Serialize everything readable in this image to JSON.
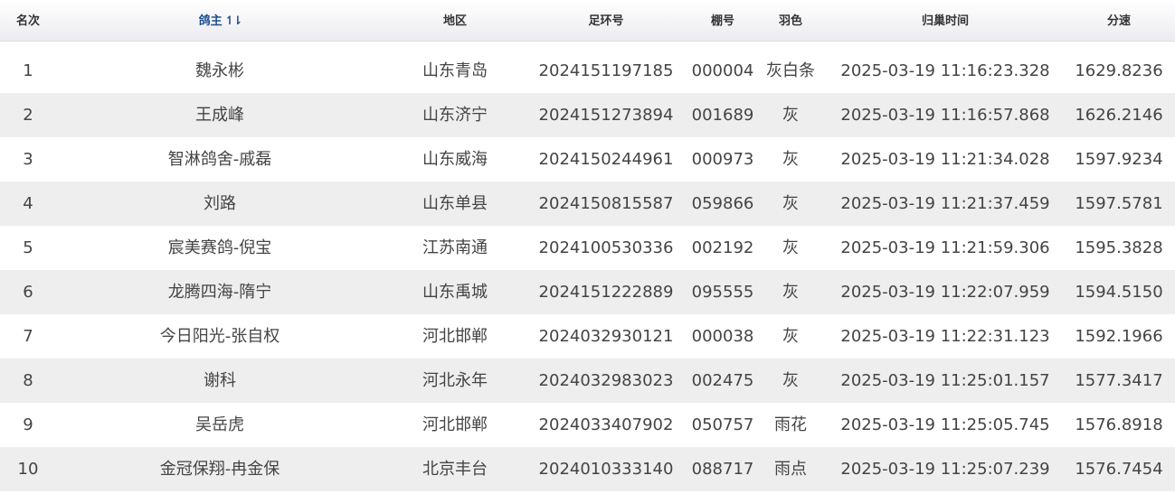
{
  "table": {
    "headers": {
      "rank": "名次",
      "owner": "鸽主",
      "region": "地区",
      "ring": "足环号",
      "shed": "棚号",
      "feather": "羽色",
      "arrival": "归巢时间",
      "speed": "分速"
    },
    "rows": [
      {
        "rank": "1",
        "owner": "魏永彬",
        "region": "山东青岛",
        "ring": "2024151197185",
        "shed": "000004",
        "feather": "灰白条",
        "arrival": "2025-03-19 11:16:23.328",
        "speed": "1629.8236"
      },
      {
        "rank": "2",
        "owner": "王成峰",
        "region": "山东济宁",
        "ring": "2024151273894",
        "shed": "001689",
        "feather": "灰",
        "arrival": "2025-03-19 11:16:57.868",
        "speed": "1626.2146"
      },
      {
        "rank": "3",
        "owner": "智淋鸽舍-戚磊",
        "region": "山东威海",
        "ring": "2024150244961",
        "shed": "000973",
        "feather": "灰",
        "arrival": "2025-03-19 11:21:34.028",
        "speed": "1597.9234"
      },
      {
        "rank": "4",
        "owner": "刘路",
        "region": "山东单县",
        "ring": "2024150815587",
        "shed": "059866",
        "feather": "灰",
        "arrival": "2025-03-19 11:21:37.459",
        "speed": "1597.5781"
      },
      {
        "rank": "5",
        "owner": "宸美赛鸽-倪宝",
        "region": "江苏南通",
        "ring": "2024100530336",
        "shed": "002192",
        "feather": "灰",
        "arrival": "2025-03-19 11:21:59.306",
        "speed": "1595.3828"
      },
      {
        "rank": "6",
        "owner": "龙腾四海-隋宁",
        "region": "山东禹城",
        "ring": "2024151222889",
        "shed": "095555",
        "feather": "灰",
        "arrival": "2025-03-19 11:22:07.959",
        "speed": "1594.5150"
      },
      {
        "rank": "7",
        "owner": "今日阳光-张自权",
        "region": "河北邯郸",
        "ring": "2024032930121",
        "shed": "000038",
        "feather": "灰",
        "arrival": "2025-03-19 11:22:31.123",
        "speed": "1592.1966"
      },
      {
        "rank": "8",
        "owner": "谢科",
        "region": "河北永年",
        "ring": "2024032983023",
        "shed": "002475",
        "feather": "灰",
        "arrival": "2025-03-19 11:25:01.157",
        "speed": "1577.3417"
      },
      {
        "rank": "9",
        "owner": "吴岳虎",
        "region": "河北邯郸",
        "ring": "2024033407902",
        "shed": "050757",
        "feather": "雨花",
        "arrival": "2025-03-19 11:25:05.745",
        "speed": "1576.8918"
      },
      {
        "rank": "10",
        "owner": "金冠保翔-冉金保",
        "region": "北京丰台",
        "ring": "2024010333140",
        "shed": "088717",
        "feather": "雨点",
        "arrival": "2025-03-19 11:25:07.239",
        "speed": "1576.7454"
      }
    ]
  },
  "colors": {
    "header_active": "#1f4e8c",
    "row_alt": "#eeeeee"
  },
  "icons": {
    "sort": "sort-toggle-icon"
  }
}
